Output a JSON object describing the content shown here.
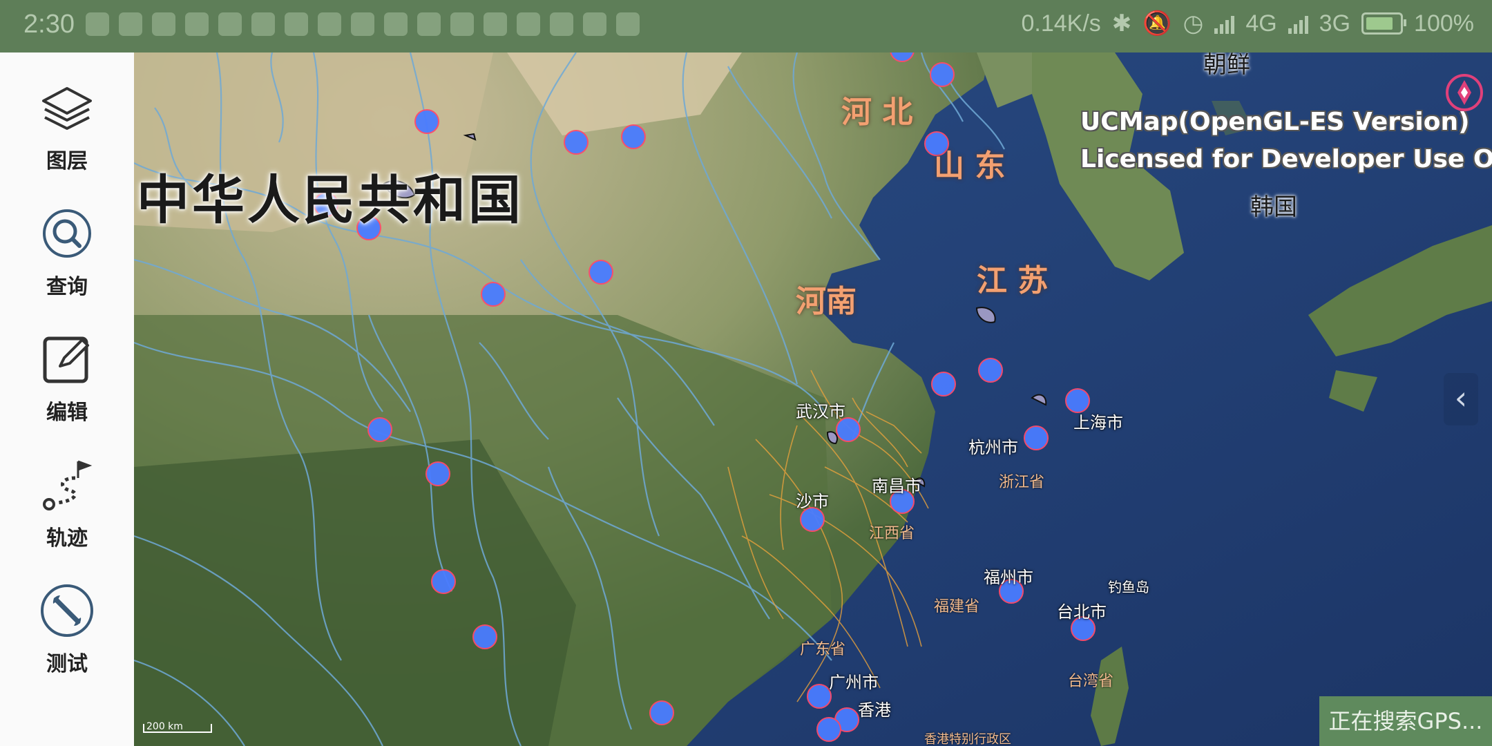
{
  "status_bar": {
    "time": "2:30",
    "network_speed": "0.14K/s",
    "network_1": "4G",
    "network_2": "3G",
    "battery": "100%"
  },
  "sidebar": {
    "items": [
      {
        "label": "图层",
        "icon": "layers-icon"
      },
      {
        "label": "查询",
        "icon": "search-icon"
      },
      {
        "label": "编辑",
        "icon": "edit-icon"
      },
      {
        "label": "轨迹",
        "icon": "track-icon"
      },
      {
        "label": "测试",
        "icon": "wrench-icon"
      }
    ]
  },
  "map": {
    "country_label": "中华人民共和国",
    "provinces": {
      "hebei": "河 北",
      "shandong": "山 东",
      "henan": "河南",
      "jiangsu": "江 苏"
    },
    "korea_labels": {
      "north": "朝鲜",
      "south": "韩国"
    },
    "cities": {
      "wuhan": "武汉市",
      "hangzhou": "杭州市",
      "shanghai": "上海市",
      "nanchang": "南昌市",
      "changsha": "沙市",
      "fuzhou": "福州市",
      "taipei": "台北市",
      "guangzhou": "广州市",
      "hongkong": "香港",
      "diaoyu": "钓鱼岛"
    },
    "small_provinces": {
      "jiangxi": "江西省",
      "fujian": "福建省",
      "guangdong": "广东省",
      "zhejiang": "浙江省",
      "taiwan": "台湾省",
      "hk_sar": "香港特别行政区"
    },
    "license_line_1": "UCMap(OpenGL-ES Version)",
    "license_line_2": "Licensed for Developer Use Only",
    "scale_label": "200 km",
    "gps_status": "正在搜索GPS..."
  },
  "colors": {
    "status_bar": "#5e7e58",
    "river": "#6fa9d6",
    "road": "#e8a23c",
    "marker": "#4a7cff",
    "marker_outline": "#ff4a6a",
    "gps_bar": "#5f8a5d"
  }
}
